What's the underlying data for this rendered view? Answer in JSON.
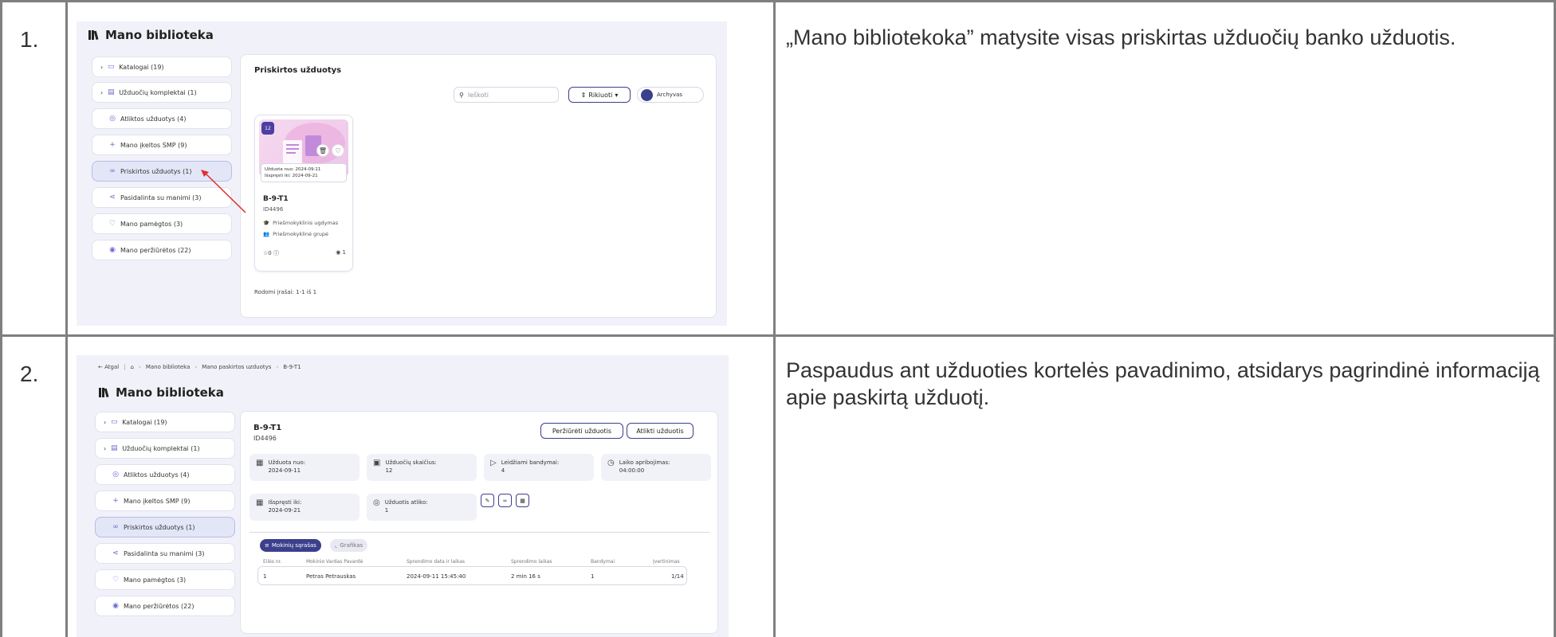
{
  "rows": [
    {
      "number": "1.",
      "description": "„Mano bibliotekoka” matysite visas priskirtas užduočių banko užduotis."
    },
    {
      "number": "2.",
      "description": "Paspaudus ant užduoties kortelės pavadinimo, atsidarys pagrindinė informaciją apie paskirtą užduotį."
    }
  ],
  "library": {
    "title": "Mano biblioteka",
    "sidebar": [
      {
        "label": "Katalogai (19)",
        "icon": "catalog-icon",
        "chevron": true
      },
      {
        "label": "Užduočių komplektai (1)",
        "icon": "sets-icon",
        "chevron": true
      },
      {
        "label": "Atliktos užduotys (4)",
        "icon": "check-circle-icon",
        "chevron": false
      },
      {
        "label": "Mano įkeltos SMP (9)",
        "icon": "plus-icon",
        "chevron": false
      },
      {
        "label": "Priskirtos užduotys (1)",
        "icon": "link-icon",
        "chevron": false,
        "active": true
      },
      {
        "label": "Pasidalinta su manimi (3)",
        "icon": "share-icon",
        "chevron": false
      },
      {
        "label": "Mano pamėgtos (3)",
        "icon": "heart-icon",
        "chevron": false
      },
      {
        "label": "Mano peržiūrėtos (22)",
        "icon": "eye-icon",
        "chevron": false
      }
    ]
  },
  "shot1": {
    "panel_title": "Priskirtos užduotys",
    "search_placeholder": "Ieškoti",
    "sort_label": "Rikiuoti",
    "archive_label": "Archyvas",
    "card": {
      "badge": "12",
      "assigned_from": "Užduota nuo: 2024-09-11",
      "solve_until": "Išspręsti iki: 2024-09-21",
      "title": "B-9-T1",
      "id": "ID4496",
      "education": "Priešmokyklinis ugdymas",
      "group": "Priešmokyklinė grupė",
      "likes": "0",
      "views": "1"
    },
    "records": "Rodomi įrašai: 1-1 iš 1"
  },
  "shot2": {
    "breadcrumb": {
      "back": "Atgal",
      "crumb1": "Mano biblioteka",
      "crumb2": "Mano paskirtos uzduotys",
      "crumb3": "B-9-T1"
    },
    "title": "B-9-T1",
    "id": "ID4496",
    "btn_view": "Peržiūrėti užduotis",
    "btn_do": "Atlikti užduotis",
    "info": [
      {
        "label": "Užduota nuo:",
        "value": "2024-09-11",
        "icon": "calendar-icon"
      },
      {
        "label": "Užduočių skaičius:",
        "value": "12",
        "icon": "list-icon"
      },
      {
        "label": "Leidžiami bandymai:",
        "value": "4",
        "icon": "play-icon"
      },
      {
        "label": "Laiko apribojimas:",
        "value": "04:00:00",
        "icon": "clock-icon"
      },
      {
        "label": "Išspręsti iki:",
        "value": "2024-09-21",
        "icon": "calendar-icon"
      },
      {
        "label": "Užduotis atliko:",
        "value": "1",
        "icon": "check-circle-icon"
      }
    ],
    "tab_list": "Mokinių sąrašas",
    "tab_chart": "Grafikas",
    "columns": [
      "Eilės nr.",
      "Mokinio Vardas Pavardė",
      "Sprendimo data ir laikas",
      "Sprendimo laikas",
      "Bandymai",
      "Įvertinimas"
    ],
    "table_rows": [
      [
        "1",
        "Petras Petrauskas",
        "2024-09-11 15:45:40",
        "2 min 16 s",
        "1",
        "1/14"
      ]
    ]
  },
  "colors": {
    "accent": "#3b3f8c",
    "arrow": "#e03030",
    "active_item": "#e3e6f7"
  }
}
